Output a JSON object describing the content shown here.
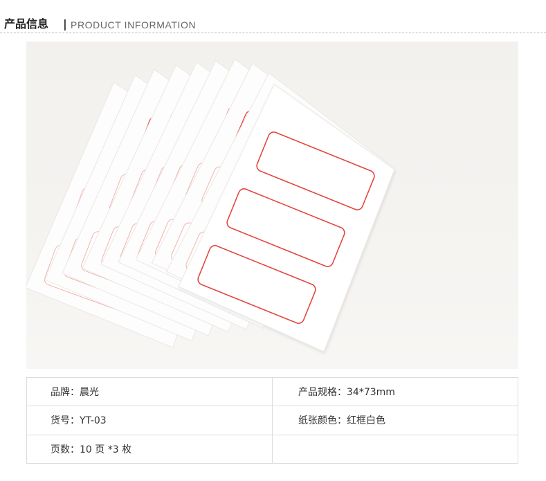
{
  "header": {
    "title_cn": "产品信息",
    "separator": "|",
    "title_en": "PRODUCT INFORMATION"
  },
  "product_image": {
    "label_frame_color": "#e2463f",
    "sticker_color": "#ffffff"
  },
  "specs": [
    [
      {
        "label": "品牌：",
        "value": "晨光"
      },
      {
        "label": "产品规格：",
        "value": "34*73mm"
      }
    ],
    [
      {
        "label": "货号：",
        "value": "YT-03"
      },
      {
        "label": "纸张颜色：",
        "value": "红框白色"
      }
    ],
    [
      {
        "label": "页数：",
        "value": "10 页 *3 枚"
      },
      {
        "label": "",
        "value": ""
      }
    ]
  ]
}
